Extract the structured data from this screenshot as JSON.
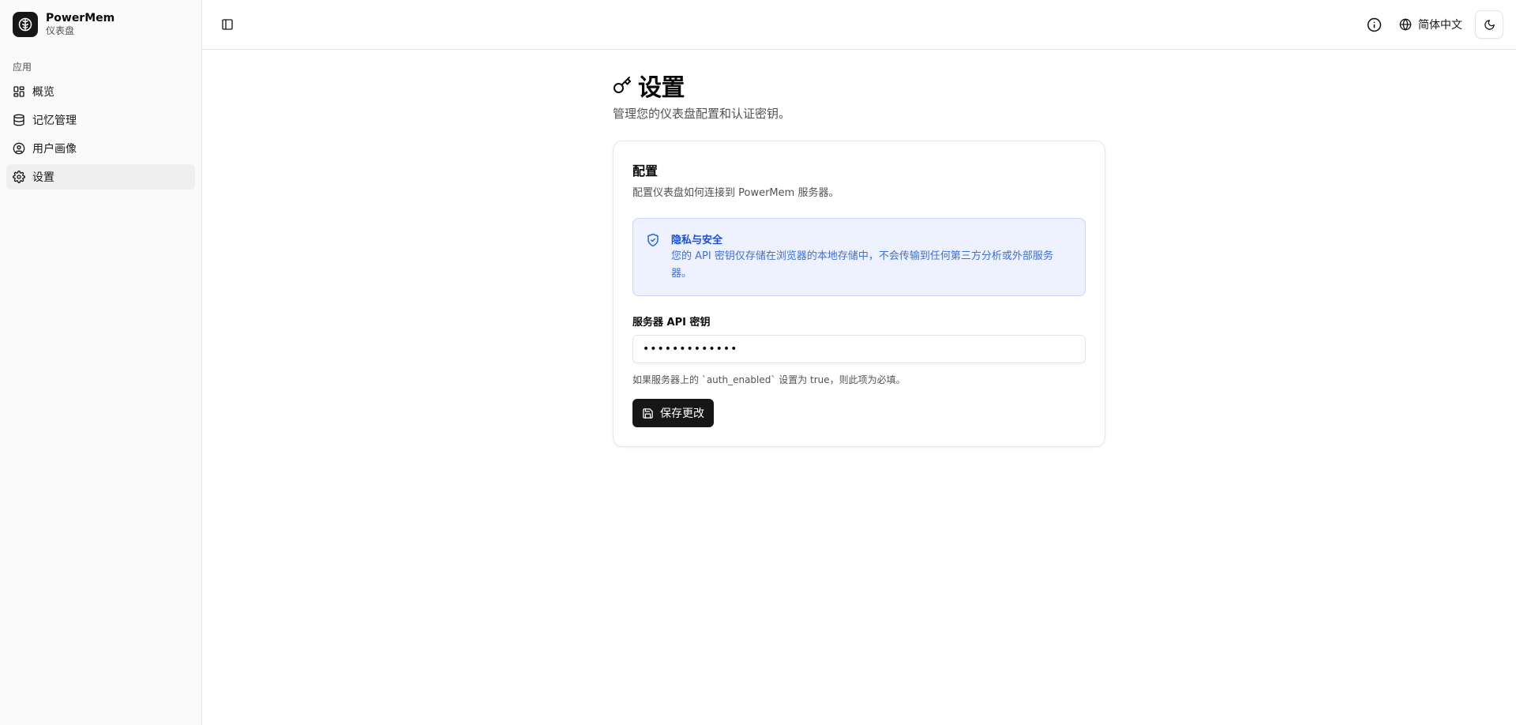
{
  "brand": {
    "name": "PowerMem",
    "subtitle": "仪表盘"
  },
  "sidebar": {
    "group_label": "应用",
    "items": [
      {
        "label": "概览",
        "icon": "dashboard-grid-icon"
      },
      {
        "label": "记忆管理",
        "icon": "database-icon"
      },
      {
        "label": "用户画像",
        "icon": "user-circle-icon"
      },
      {
        "label": "设置",
        "icon": "gear-icon",
        "active": true
      }
    ]
  },
  "header": {
    "language_label": "简体中文"
  },
  "page": {
    "title": "设置",
    "description": "管理您的仪表盘配置和认证密钥。"
  },
  "card": {
    "title": "配置",
    "description": "配置仪表盘如何连接到 PowerMem 服务器。",
    "alert": {
      "title": "隐私与安全",
      "body": "您的 API 密钥仅存储在浏览器的本地存储中，不会传输到任何第三方分析或外部服务器。"
    },
    "field_label": "服务器 API 密钥",
    "field_value": "•••••••••••••",
    "hint": "如果服务器上的 `auth_enabled` 设置为 true，则此项为必填。",
    "save_label": "保存更改"
  },
  "colors": {
    "accent_blue": "#2563eb",
    "alert_bg": "#eef2ff",
    "primary_button": "#171717"
  }
}
